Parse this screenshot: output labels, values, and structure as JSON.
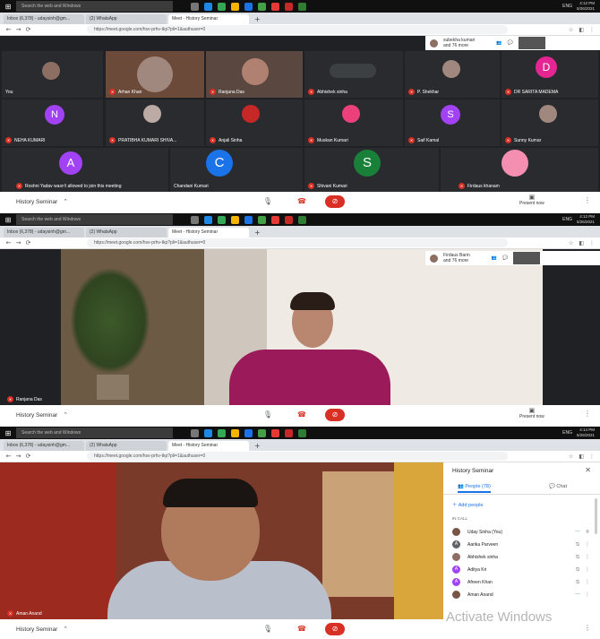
{
  "taskbar": {
    "search_placeholder": "Search the web and Windows",
    "tray_lang": "ENG",
    "screens": [
      {
        "time": "4:12 PM",
        "date": "5/26/2021"
      },
      {
        "time": "4:12 PM",
        "date": "5/26/2021"
      },
      {
        "time": "4:14 PM",
        "date": "5/26/2021"
      }
    ]
  },
  "browser": {
    "tabs": [
      {
        "label": "Inbox (6,378) - udaysinh@gm..."
      },
      {
        "label": "(2) WhatsApp"
      },
      {
        "label": "Meet - History Seminar"
      }
    ],
    "url": "https://meet.google.com/hsv-prhv-tkp?pli=1&authuser=0"
  },
  "screen1": {
    "header": {
      "presenter": "subekha kumari",
      "presenter_more": "and 76 more"
    },
    "tiles": [
      {
        "name": "You",
        "initial": "",
        "color": "#5f6368"
      },
      {
        "name": "Arhan Khan",
        "initial": "",
        "color": "#444"
      },
      {
        "name": "Ranjana Das",
        "initial": "",
        "color": "#444"
      },
      {
        "name": "Abhishek sinha",
        "initial": "",
        "color": "#444"
      },
      {
        "name": "P. Shekhar",
        "initial": "",
        "color": "#444"
      },
      {
        "name": "DR SARITA MADEMA",
        "initial": "D",
        "color": "#e52592"
      },
      {
        "name": "NEHA KUMARI",
        "initial": "N",
        "color": "#a142f4"
      },
      {
        "name": "PRATIBHA KUMARI SHIVA...",
        "initial": "",
        "color": "#444"
      },
      {
        "name": "Anjali Sinha",
        "initial": "",
        "color": "#444"
      },
      {
        "name": "Muskan Kumari",
        "initial": "",
        "color": "#444"
      },
      {
        "name": "Saif Kamal",
        "initial": "S",
        "color": "#a142f4"
      },
      {
        "name": "Sunny Kumar",
        "initial": "",
        "color": "#444"
      },
      {
        "name": "Roshni Yadav wasn't allowed to join this meeting",
        "initial": "A",
        "color": "#a142f4"
      },
      {
        "name": "Chandani Kumari",
        "initial": "C",
        "color": "#1a73e8"
      },
      {
        "name": "Shivani Kumari",
        "initial": "S",
        "color": "#188038"
      },
      {
        "name": "Firdaus khanam",
        "initial": "",
        "color": "#444"
      }
    ]
  },
  "screen2": {
    "header": {
      "presenter": "Firdaus Barin",
      "presenter_more": "and 76 more"
    },
    "speaker": "Ranjana Das"
  },
  "screen3": {
    "speaker": "Aman Anand",
    "side_panel": {
      "title": "History Seminar",
      "tab_people": "People (78)",
      "tab_chat": "Chat",
      "add_people": "Add people",
      "in_call": "IN CALL",
      "participants": [
        {
          "name": "Uday Sinha (You)",
          "initial": "",
          "color": "#795548"
        },
        {
          "name": "Aarika Parveen",
          "initial": "A",
          "color": "#5f6368"
        },
        {
          "name": "Abhishek sinha",
          "initial": "",
          "color": "#8d6e63"
        },
        {
          "name": "Aditya Kri",
          "initial": "A",
          "color": "#a142f4"
        },
        {
          "name": "Afreen Khan",
          "initial": "A",
          "color": "#a142f4"
        },
        {
          "name": "Aman Anand",
          "initial": "",
          "color": "#795548"
        }
      ]
    }
  },
  "meeting_bar": {
    "title": "History Seminar",
    "present_label": "Present now"
  },
  "watermark": "Activate Windows"
}
